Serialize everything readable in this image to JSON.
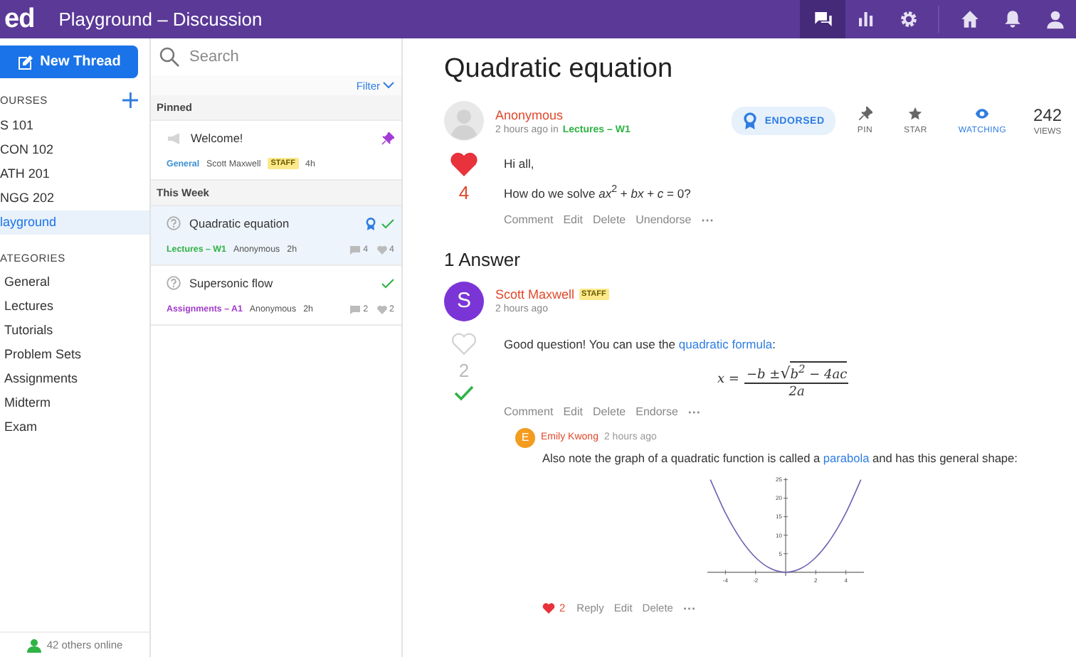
{
  "header": {
    "logo": "ed",
    "title": "Playground – Discussion",
    "tools": [
      {
        "kind": "chat",
        "selected": true
      },
      {
        "kind": "stats",
        "selected": false
      },
      {
        "kind": "settings",
        "selected": false
      }
    ],
    "nav": [
      {
        "kind": "home"
      },
      {
        "kind": "bell"
      },
      {
        "kind": "user"
      }
    ]
  },
  "sidebar": {
    "new_thread": "New Thread",
    "courses_heading": "OURSES",
    "courses": [
      {
        "label": "S 101",
        "selected": false
      },
      {
        "label": "CON 102",
        "selected": false
      },
      {
        "label": "ATH 201",
        "selected": false
      },
      {
        "label": "NGG 202",
        "selected": false
      },
      {
        "label": "layground",
        "selected": true
      }
    ],
    "categories_heading": "ATEGORIES",
    "categories": [
      "General",
      "Lectures",
      "Tutorials",
      "Problem Sets",
      "Assignments",
      "Midterm",
      "Exam"
    ],
    "online": "42 others online"
  },
  "thread_list": {
    "search_placeholder": "Search",
    "filter": "Filter",
    "groups": [
      {
        "title": "Pinned",
        "threads": [
          {
            "kind": "announcement",
            "title": "Welcome!",
            "category": "General",
            "color": "#3d8fd1",
            "author": "Scott Maxwell",
            "badge": "STAFF",
            "time": "4h",
            "selected": false,
            "pinned": true,
            "endorsed": false,
            "answered": false
          }
        ]
      },
      {
        "title": "This Week",
        "threads": [
          {
            "kind": "question",
            "title": "Quadratic equation",
            "category": "Lectures – W1",
            "color": "#2fb344",
            "author": "Anonymous",
            "time": "2h",
            "selected": true,
            "pinned": false,
            "endorsed": true,
            "answered": true,
            "comments": "4",
            "likes": "4"
          },
          {
            "kind": "question",
            "title": "Supersonic flow",
            "category": "Assignments – A1",
            "color": "#a23bc9",
            "author": "Anonymous",
            "time": "2h",
            "selected": false,
            "pinned": false,
            "endorsed": false,
            "answered": true,
            "comments": "2",
            "likes": "2"
          }
        ]
      }
    ]
  },
  "thread": {
    "title": "Quadratic equation",
    "author": "Anonymous",
    "time": "2 hours ago in",
    "category": "Lectures – W1",
    "endorsed": "ENDORSED",
    "actions": [
      {
        "kind": "pin",
        "label": "PIN",
        "on": false
      },
      {
        "kind": "star",
        "label": "STAR",
        "on": false
      },
      {
        "kind": "watch",
        "label": "WATCHING",
        "on": true
      }
    ],
    "views": "242",
    "views_label": "VIEWS",
    "liked": true,
    "likes": "4",
    "body": [
      "Hi all,",
      "How do we solve *ax*$^{2}$ + *bx* + *c* = 0?"
    ],
    "links": [
      "Comment",
      "Edit",
      "Delete",
      "Unendorse"
    ],
    "more": "···"
  },
  "answers_heading": "1 Answer",
  "answer": {
    "avatar": "S",
    "color": "#7b35d6",
    "author": "Scott Maxwell",
    "badge": "STAFF",
    "time": "2 hours ago",
    "liked": false,
    "likes": "2",
    "accepted": true,
    "text": "Good question! You can use the",
    "link": "quadratic formula",
    "after": ":",
    "formula": {
      "lhs": "x =",
      "minus_b": "−b ±",
      "radical": "√",
      "radicand": "b$^{2}$ − 4ac",
      "denominator": "2a"
    },
    "links": [
      "Comment",
      "Edit",
      "Delete",
      "Endorse"
    ],
    "more": "···",
    "comment": {
      "avatar": "E",
      "color": "#f39c1f",
      "author": "Emily Kwong",
      "time": "2 hours ago",
      "text": "Also note the graph of a quadratic function is called a",
      "link": "parabola",
      "after": "and has this general shape:",
      "chart_data": {
        "type": "line",
        "x": [
          -5,
          -4,
          -3,
          -2,
          -1,
          0,
          1,
          2,
          3,
          4,
          5
        ],
        "series": [
          {
            "color": "#6c63b0",
            "values": [
              25,
              16,
              9,
              4,
              1,
              0,
              1,
              4,
              9,
              16,
              25
            ]
          }
        ],
        "xlim": [
          -5.2,
          5.2
        ],
        "ylim": [
          -1,
          25.5
        ],
        "xticks": [
          -4,
          -2,
          2,
          4
        ],
        "yticks": [
          5,
          10,
          15,
          20,
          25
        ]
      },
      "liked": true,
      "likes": "2",
      "links": [
        "Reply",
        "Edit",
        "Delete"
      ],
      "more": "···"
    }
  }
}
